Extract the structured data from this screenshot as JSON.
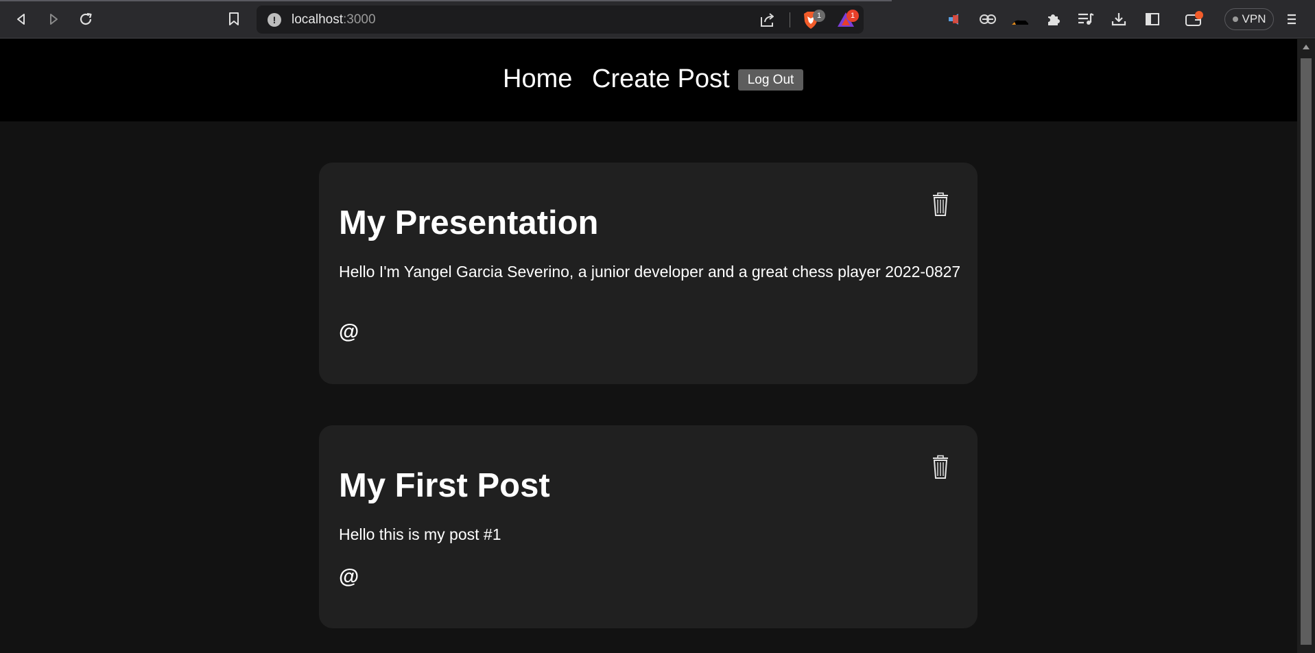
{
  "browser": {
    "url_host": "localhost",
    "url_port": ":3000",
    "brave_shields_count": "1",
    "rewards_count": "1",
    "vpn_label": "VPN",
    "icons": [
      "back-icon",
      "forward-icon",
      "reload-icon",
      "bookmark-icon",
      "info-icon",
      "share-icon",
      "brave-shields-icon",
      "brave-rewards-icon",
      "extension-icon",
      "extension-icon",
      "extension-icon",
      "puzzle-icon",
      "playlist-icon",
      "download-icon",
      "sidebar-icon",
      "wallet-icon",
      "menu-icon"
    ]
  },
  "nav": {
    "home": "Home",
    "create_post": "Create Post",
    "logout": "Log Out"
  },
  "posts": [
    {
      "title": "My Presentation",
      "body": "Hello I'm Yangel Garcia Severino, a junior developer and a great chess player 2022-0827",
      "author": "@"
    },
    {
      "title": "My First Post",
      "body": "Hello this is my post #1",
      "author": "@"
    }
  ],
  "colors": {
    "page_background": "#121212",
    "navbar_background": "#000000",
    "card_background": "#202020",
    "logout_button": "#5d5d5d",
    "brave_orange": "#f25c2a",
    "badge_red": "#e8402a"
  }
}
